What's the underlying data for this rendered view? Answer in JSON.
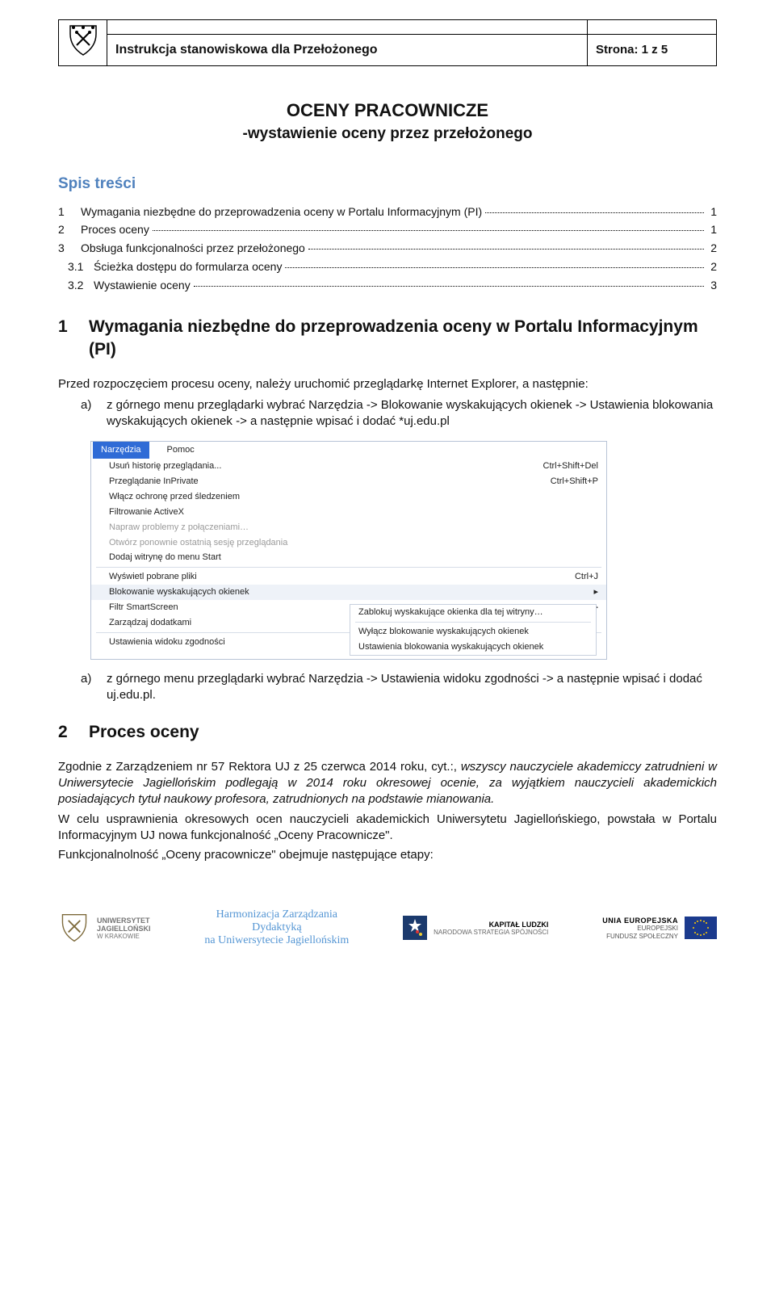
{
  "header": {
    "doc_title": "Instrukcja stanowiskowa dla Przełożonego",
    "page_label": "Strona: 1 z 5"
  },
  "title": {
    "line1": "OCENY PRACOWNICZE",
    "line2": "-wystawienie oceny przez przełożonego"
  },
  "toc": {
    "heading": "Spis treści",
    "items": [
      {
        "num": "1",
        "text": "Wymagania niezbędne do przeprowadzenia oceny w Portalu Informacyjnym (PI)",
        "page": "1"
      },
      {
        "num": "2",
        "text": "Proces oceny",
        "page": "1"
      },
      {
        "num": "3",
        "text": "Obsługa funkcjonalności przez przełożonego",
        "page": "2"
      },
      {
        "num": "3.1",
        "text": "Ścieżka dostępu do formularza oceny",
        "page": "2",
        "sub": true
      },
      {
        "num": "3.2",
        "text": "Wystawienie oceny",
        "page": "3",
        "sub": true
      }
    ]
  },
  "section1": {
    "num": "1",
    "title": "Wymagania niezbędne do przeprowadzenia oceny w Portalu Informacyjnym (PI)",
    "intro": "Przed rozpoczęciem procesu oceny, należy uruchomić przeglądarkę Internet Explorer, a następnie:",
    "item_a_label": "a)",
    "item_a_text": "z górnego menu przeglądarki wybrać Narzędzia -> Blokowanie wyskakujących okienek -> Ustawienia blokowania wyskakujących okienek -> a następnie wpisać i dodać *uj.edu.pl",
    "item_a2_label": "a)",
    "item_a2_text": "z górnego menu przeglądarki wybrać Narzędzia -> Ustawienia widoku zgodności -> a następnie wpisać i dodać uj.edu.pl."
  },
  "menu_fig": {
    "tabs": [
      "Narzędzia",
      "Pomoc"
    ],
    "rows": [
      {
        "l": "Usuń historię przeglądania...",
        "r": "Ctrl+Shift+Del"
      },
      {
        "l": "Przeglądanie InPrivate",
        "r": "Ctrl+Shift+P"
      },
      {
        "l": "Włącz ochronę przed śledzeniem",
        "r": ""
      },
      {
        "l": "Filtrowanie ActiveX",
        "r": ""
      },
      {
        "l": "Napraw problemy z połączeniami…",
        "r": "",
        "fade": true
      },
      {
        "l": "Otwórz ponownie ostatnią sesję przeglądania",
        "r": "",
        "fade": true
      },
      {
        "l": "Dodaj witrynę do menu Start",
        "r": ""
      },
      {
        "sep": true
      },
      {
        "l": "Wyświetl pobrane pliki",
        "r": "Ctrl+J"
      },
      {
        "l": "Blokowanie wyskakujących okienek",
        "r": "▸",
        "sel": true
      },
      {
        "l": "Filtr SmartScreen",
        "r": "▸"
      },
      {
        "l": "Zarządzaj dodatkami",
        "r": ""
      },
      {
        "sep": true
      },
      {
        "l": "Ustawienia widoku zgodności",
        "r": ""
      }
    ],
    "submenu": [
      {
        "l": "Zablokuj wyskakujące okienka dla tej witryny…"
      },
      {
        "sep": true
      },
      {
        "l": "Wyłącz blokowanie wyskakujących okienek"
      },
      {
        "l": "Ustawienia blokowania wyskakujących okienek"
      }
    ]
  },
  "section2": {
    "num": "2",
    "title": "Proces oceny",
    "p1_lead": "Zgodnie z Zarządzeniem nr 57 Rektora UJ z 25 czerwca 2014 roku, cyt.:, ",
    "p1_italic": "wszyscy nauczyciele akademiccy zatrudnieni w Uniwersytecie Jagiellońskim podlegają w 2014 roku okresowej ocenie, za wyjątkiem nauczycieli akademickich posiadających tytuł naukowy profesora, zatrudnionych na podstawie mianowania.",
    "p2": "W celu usprawnienia okresowych ocen nauczycieli akademickich Uniwersytetu Jagiellońskiego, powstała w Portalu Informacyjnym UJ nowa funkcjonalność „Oceny Pracownicze\".",
    "p3": "Funkcjonalnolność „Oceny pracownicze\" obejmuje następujące etapy:"
  },
  "footer": {
    "uj1": "UNIWERSYTET",
    "uj2": "JAGIELLOŃSKI",
    "uj3": "W KRAKOWIE",
    "hm1": "Harmonizacja Zarządzania",
    "hm2": "Dydaktyką",
    "hm3": "na Uniwersytecie Jagiellońskim",
    "kl1": "KAPITAŁ LUDZKI",
    "kl2": "NARODOWA STRATEGIA SPÓJNOŚCI",
    "eu1": "UNIA EUROPEJSKA",
    "eu2": "EUROPEJSKI",
    "eu3": "FUNDUSZ SPOŁECZNY"
  }
}
